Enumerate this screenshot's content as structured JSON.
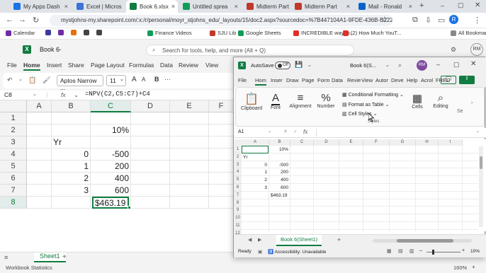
{
  "browser": {
    "tabs": [
      {
        "label": "My Apps Dash",
        "color": "#1a73e8",
        "active": false
      },
      {
        "label": "Excel | Micros",
        "color": "#3b73d6",
        "active": false
      },
      {
        "label": "Book 6.xlsx",
        "color": "#107c41",
        "active": true
      },
      {
        "label": "Untitled sprea",
        "color": "#0f9d58",
        "active": false
      },
      {
        "label": "Midterm Part",
        "color": "#c0392b",
        "active": false
      },
      {
        "label": "Midterm Part",
        "color": "#c0392b",
        "active": false
      },
      {
        "label": "Mail - Ronald",
        "color": "#0a64c8",
        "active": false
      }
    ],
    "new_tab": "+",
    "url": "mystjohns-my.sharepoint.com/:x:/r/personal/moyr_stjohns_edu/_layouts/15/doc2.aspx?sourcedoc=%7B447104A1-9FDE-436B-B222-...",
    "profile": "R",
    "bookmarks": [
      {
        "label": "Calendar",
        "color": "#6f2da8"
      },
      {
        "label": "",
        "color": "#3c3c9c"
      },
      {
        "label": "",
        "color": "#6f2da8"
      },
      {
        "label": "",
        "color": "#e8710a"
      },
      {
        "label": "",
        "color": "#444"
      },
      {
        "label": "",
        "color": "#444"
      },
      {
        "label": "Finance Videos",
        "color": "#0f9d58"
      },
      {
        "label": "SJU Lib",
        "color": "#c0392b"
      },
      {
        "label": "Google Sheets",
        "color": "#0f9d58"
      },
      {
        "label": "INCREDIBLE way to...",
        "color": "#e52d27"
      },
      {
        "label": "(2) How Much YouT...",
        "color": "#e52d27"
      }
    ],
    "all_bookmarks": "All Bookmarks"
  },
  "excel_web": {
    "app_title": "Book 6",
    "search_placeholder": "Search for tools, help, and more (Alt + Q)",
    "avatar": "RM",
    "menu": [
      "File",
      "Home",
      "Insert",
      "Share",
      "Page Layout",
      "Formulas",
      "Data",
      "Review",
      "View"
    ],
    "active_menu": "Home",
    "font_name": "Aptos Narrow ...",
    "font_size": "11",
    "namebox": "C8",
    "formula": "=NPV(C2,C5:C7)+C4",
    "fx": "fx",
    "columns": [
      "A",
      "B",
      "C",
      "D",
      "E",
      "F"
    ],
    "rows": [
      "1",
      "2",
      "3",
      "4",
      "5",
      "6",
      "7",
      "8"
    ],
    "cells": {
      "C2": "10%",
      "B3": "Yr",
      "B4": "0",
      "C4": "-500",
      "B5": "1",
      "C5": "200",
      "B6": "2",
      "C6": "400",
      "B7": "3",
      "C7": "600",
      "C8": "$463.19"
    },
    "sheet": "Sheet1",
    "add_sheet": "+",
    "status_left": "Workbook Statistics",
    "zoom": "160%"
  },
  "excel_desktop": {
    "autosave": "AutoSave",
    "autosave_state": "Off",
    "title": "Book 6(S...",
    "menu": [
      "File",
      "Hom",
      "Inser",
      "Draw",
      "Page",
      "Form",
      "Data",
      "Revie",
      "View",
      "Autor",
      "Deve",
      "Help",
      "Acrol",
      "FRED"
    ],
    "active_menu": "Hom",
    "ribbon": {
      "clipboard": "Clipboard",
      "font": "Font",
      "alignment": "Alignment",
      "number": "Number",
      "cond_format": "Conditional Formatting",
      "format_table": "Format as Table",
      "cell_styles": "Cell Styles",
      "styles_group": "Styles",
      "cells": "Cells",
      "editing": "Editing",
      "sensitivity": "Se"
    },
    "namebox": "A1",
    "fx": "fx",
    "columns": [
      "A",
      "B",
      "C",
      "D",
      "E",
      "F",
      "G",
      "H",
      "I"
    ],
    "rows": [
      "1",
      "2",
      "3",
      "4",
      "5",
      "6",
      "7",
      "8",
      "9",
      "10",
      "11",
      "12"
    ],
    "cells": {
      "B1": "10%",
      "A2": "Yr",
      "A3": "0",
      "B3": "-500",
      "A4": "1",
      "B4": "200",
      "A5": "2",
      "B5": "400",
      "A6": "3",
      "B6": "600",
      "B7": "$463.19"
    },
    "sheet_tab": "Book 6(Sheet1)",
    "status_ready": "Ready",
    "accessibility": "Accessibility: Unavailable",
    "zoom": "10%"
  }
}
